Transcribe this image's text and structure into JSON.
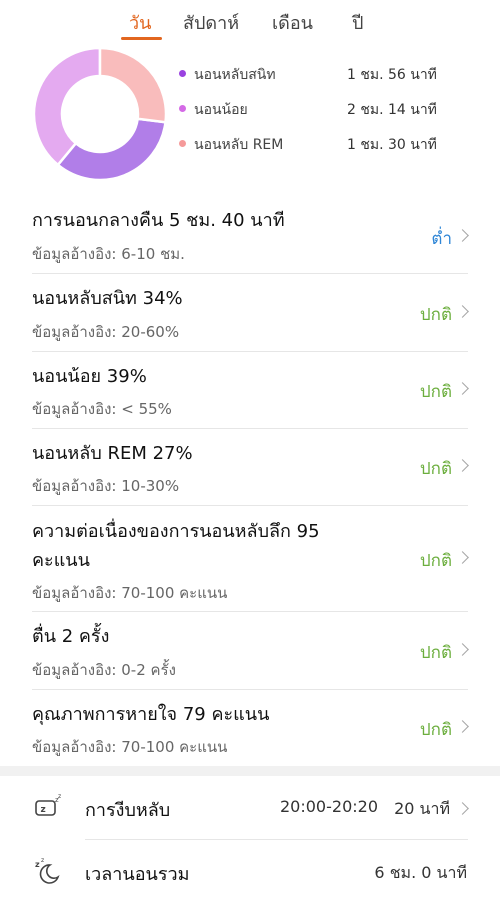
{
  "tabs": [
    {
      "label": "วัน",
      "active": true
    },
    {
      "label": "สัปดาห์",
      "active": false
    },
    {
      "label": "เดือน",
      "active": false
    },
    {
      "label": "ปี",
      "active": false
    }
  ],
  "colors": {
    "accent": "#e2661f",
    "deep_sleep": "#b17ee8",
    "light_sleep": "#e4aaf0",
    "rem_sleep": "#f9bcbc",
    "status_normal": "#6cae3e",
    "status_low": "#2f86d6"
  },
  "donut": {
    "segments": [
      {
        "name": "deep",
        "percent": 34
      },
      {
        "name": "light",
        "percent": 39
      },
      {
        "name": "rem",
        "percent": 27
      }
    ]
  },
  "legend": [
    {
      "label": "นอนหลับสนิท",
      "value": "1 ชม. 56 นาที",
      "color": "#9a42e0"
    },
    {
      "label": "นอนน้อย",
      "value": "2 ชม. 14 นาที",
      "color": "#d46ae6"
    },
    {
      "label": "นอนหลับ REM",
      "value": "1 ชม. 30 นาที",
      "color": "#f59a9a"
    }
  ],
  "metrics": [
    {
      "title": "การนอนกลางคืน  5 ชม. 40 นาที",
      "reference": "ข้อมูลอ้างอิง: 6-10 ชม.",
      "status": "ต่ำ"
    },
    {
      "title": "นอนหลับสนิท  34%",
      "reference": "ข้อมูลอ้างอิง: 20-60%",
      "status": "ปกติ"
    },
    {
      "title": "นอนน้อย  39%",
      "reference": "ข้อมูลอ้างอิง: < 55%",
      "status": "ปกติ"
    },
    {
      "title": "นอนหลับ REM  27%",
      "reference": "ข้อมูลอ้างอิง: 10-30%",
      "status": "ปกติ"
    },
    {
      "title_line1": "ความต่อเนื่องของการนอนหลับลึก  95",
      "title_line2": "คะแนน",
      "reference": "ข้อมูลอ้างอิง: 70-100 คะแนน",
      "status": "ปกติ"
    },
    {
      "title": "ตื่น  2 ครั้ง",
      "reference": "ข้อมูลอ้างอิง: 0-2 ครั้ง",
      "status": "ปกติ"
    },
    {
      "title": "คุณภาพการหายใจ  79 คะแนน",
      "reference": "ข้อมูลอ้างอิง: 70-100 คะแนน",
      "status": "ปกติ"
    }
  ],
  "nap": {
    "label": "การงีบหลับ",
    "time": "20:00-20:20",
    "duration": "20 นาที",
    "icon": "nap-icon"
  },
  "total": {
    "label": "เวลานอนรวม",
    "value": "6 ชม. 0 นาที",
    "icon": "moon-sleep-icon"
  }
}
